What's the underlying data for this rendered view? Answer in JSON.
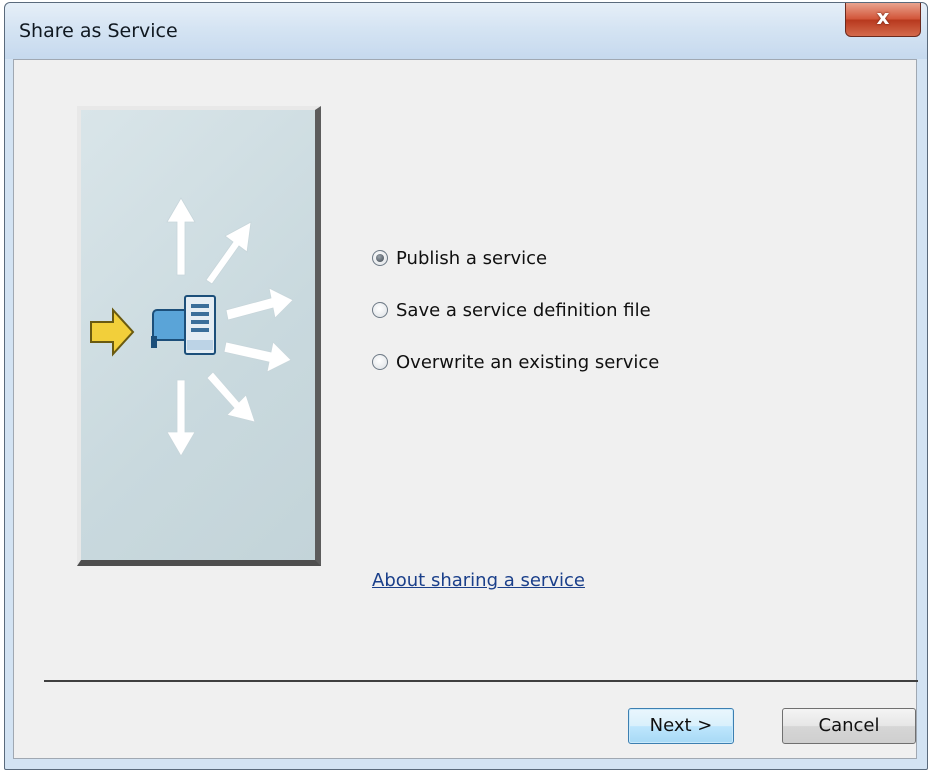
{
  "window": {
    "title": "Share as Service",
    "close_glyph": "x"
  },
  "options": [
    {
      "label": "Publish a service",
      "checked": true
    },
    {
      "label": "Save a service definition file",
      "checked": false
    },
    {
      "label": "Overwrite an existing service",
      "checked": false
    }
  ],
  "help_link": "About sharing a service",
  "buttons": {
    "next": "Next >",
    "cancel": "Cancel"
  },
  "illustration": {
    "icons": [
      "yellow-arrow-icon",
      "server-icon",
      "white-arrows-icon"
    ]
  }
}
